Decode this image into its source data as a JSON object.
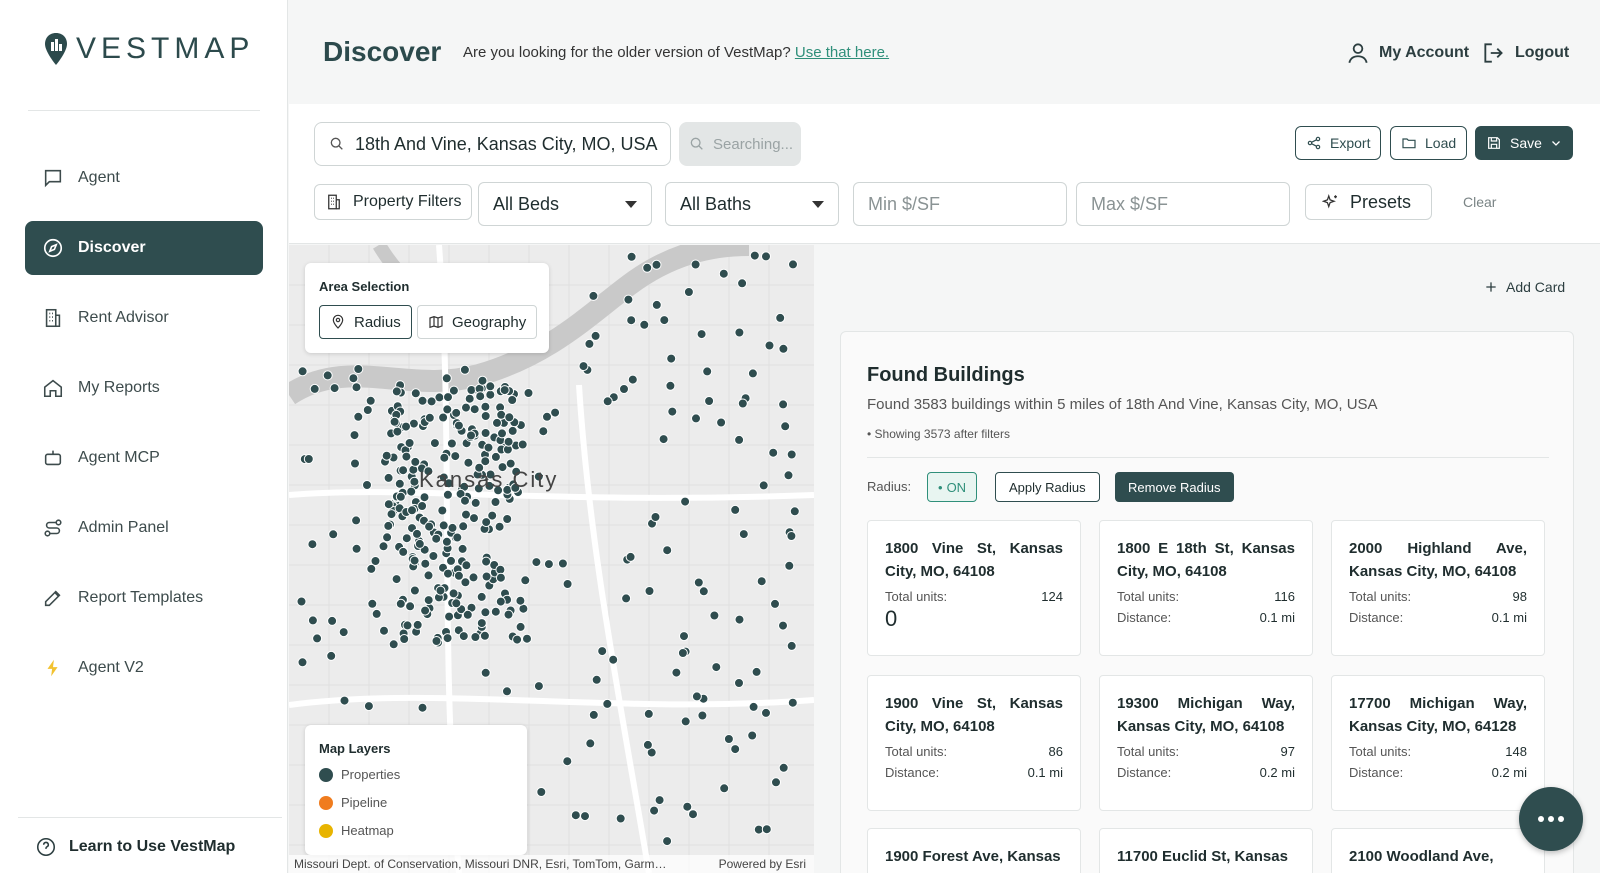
{
  "brand": {
    "name": "VESTMAP",
    "accent": "#2f4d4f",
    "link_color": "#2f8f7a"
  },
  "sidebar": {
    "items": [
      {
        "label": "Agent",
        "icon": "chat-icon"
      },
      {
        "label": "Discover",
        "icon": "compass-icon",
        "active": true
      },
      {
        "label": "Rent Advisor",
        "icon": "building-icon"
      },
      {
        "label": "My Reports",
        "icon": "home-icon"
      },
      {
        "label": "Agent MCP",
        "icon": "robot-icon"
      },
      {
        "label": "Admin Panel",
        "icon": "route-icon"
      },
      {
        "label": "Report Templates",
        "icon": "pencil-icon"
      },
      {
        "label": "Agent V2",
        "icon": "bolt-icon"
      }
    ],
    "learn_label": "Learn to Use VestMap"
  },
  "header": {
    "title": "Discover",
    "older_text": "Are you looking for the older version of VestMap?",
    "older_link": "Use that here.",
    "account_label": "My Account",
    "logout_label": "Logout"
  },
  "toolbar": {
    "search_value": "18th And Vine, Kansas City, MO, USA",
    "searching_label": "Searching...",
    "export_label": "Export",
    "load_label": "Load",
    "save_label": "Save",
    "property_filters_label": "Property Filters",
    "beds_value": "All Beds",
    "baths_value": "All Baths",
    "min_placeholder": "Min $/SF",
    "max_placeholder": "Max $/SF",
    "presets_label": "Presets",
    "clear_label": "Clear"
  },
  "map": {
    "city_label": "Kansas City",
    "area_selection_title": "Area Selection",
    "radius_label": "Radius",
    "geography_label": "Geography",
    "layers_title": "Map Layers",
    "layers": [
      {
        "label": "Properties",
        "color": "#2f4d4f"
      },
      {
        "label": "Pipeline",
        "color": "#f07c1e"
      },
      {
        "label": "Heatmap",
        "color": "#e8b400"
      }
    ],
    "attribution": "Missouri Dept. of Conservation, Missouri DNR, Esri, TomTom, Garm…",
    "powered_by": "Powered by Esri"
  },
  "results": {
    "add_card_label": "Add Card",
    "title": "Found Buildings",
    "subtitle": "Found 3583 buildings within 5 miles of 18th And Vine, Kansas City, MO, USA",
    "showing": "• Showing 3573 after filters",
    "radius_label": "Radius:",
    "on_label": "ON",
    "apply_label": "Apply Radius",
    "remove_label": "Remove Radius",
    "units_label": "Total units:",
    "distance_label": "Distance:",
    "cards": [
      {
        "address": "1800 Vine St, Kansas City, MO, 64108",
        "units": "124",
        "distance": "",
        "extra": "0"
      },
      {
        "address": "1800 E 18th St, Kansas City, MO, 64108",
        "units": "116",
        "distance": "0.1 mi"
      },
      {
        "address": "2000 Highland Ave, Kansas City, MO, 64108",
        "units": "98",
        "distance": "0.1 mi"
      },
      {
        "address": "1900 Vine St, Kansas City, MO, 64108",
        "units": "86",
        "distance": "0.1 mi"
      },
      {
        "address": "19300 Michigan Way, Kansas City, MO, 64108",
        "units": "97",
        "distance": "0.2 mi"
      },
      {
        "address": "17700 Michigan Way, Kansas City, MO, 64128",
        "units": "148",
        "distance": "0.2 mi"
      },
      {
        "address": "1900 Forest Ave, Kansas"
      },
      {
        "address": "11700 Euclid St, Kansas"
      },
      {
        "address": "2100 Woodland Ave,"
      }
    ]
  }
}
